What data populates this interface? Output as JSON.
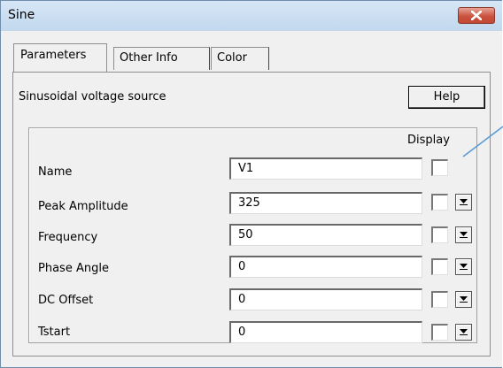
{
  "window": {
    "title": "Sine"
  },
  "tabs": [
    {
      "label": "Parameters",
      "active": true
    },
    {
      "label": "Other Info",
      "active": false
    },
    {
      "label": "Color",
      "active": false
    }
  ],
  "panel": {
    "description": "Sinusoidal voltage source",
    "help_label": "Help",
    "display_header": "Display"
  },
  "params": [
    {
      "label": "Name",
      "value": "V1",
      "has_dropdown": false
    },
    {
      "label": "Peak Amplitude",
      "value": "325",
      "has_dropdown": true
    },
    {
      "label": "Frequency",
      "value": "50",
      "has_dropdown": true
    },
    {
      "label": "Phase Angle",
      "value": "0",
      "has_dropdown": true
    },
    {
      "label": "DC Offset",
      "value": "0",
      "has_dropdown": true
    },
    {
      "label": "Tstart",
      "value": "0",
      "has_dropdown": true
    }
  ],
  "colors": {
    "callout": "#5b9bd5"
  }
}
